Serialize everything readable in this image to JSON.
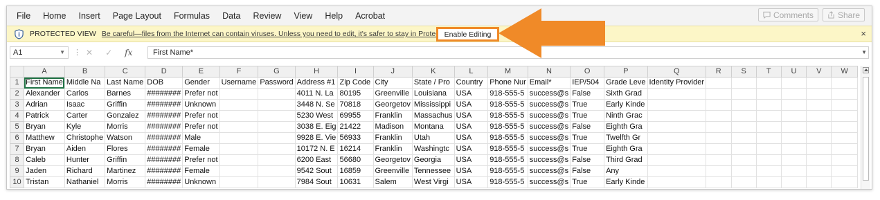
{
  "menu": {
    "items": [
      "File",
      "Home",
      "Insert",
      "Page Layout",
      "Formulas",
      "Data",
      "Review",
      "View",
      "Help",
      "Acrobat"
    ],
    "comments_label": "Comments",
    "share_label": "Share"
  },
  "protected_view": {
    "title": "PROTECTED VIEW",
    "message": "Be careful—files from the Internet can contain viruses. Unless you need to edit, it's safer to stay in Protected View.",
    "button_label": "Enable Editing",
    "close_glyph": "×"
  },
  "formula_bar": {
    "cell_ref": "A1",
    "dots": "⋮",
    "cancel_glyph": "✕",
    "enter_glyph": "✓",
    "fx_glyph": "fx",
    "content": "First Name*"
  },
  "grid": {
    "columns": [
      "A",
      "B",
      "C",
      "D",
      "E",
      "F",
      "G",
      "H",
      "I",
      "J",
      "K",
      "L",
      "M",
      "N",
      "O",
      "P",
      "Q",
      "R",
      "S",
      "T",
      "U",
      "V",
      "W"
    ],
    "row_numbers": [
      "1",
      "2",
      "3",
      "4",
      "5",
      "6",
      "7",
      "8",
      "9",
      "10"
    ],
    "rows": [
      [
        "First Name",
        "Middle Na",
        "Last Name",
        "DOB",
        "Gender",
        "Username",
        "Password",
        "Address #1",
        "Zip Code",
        "City",
        "State / Pro",
        "Country",
        "Phone Nur",
        "Email*",
        "IEP/504",
        "Grade Leve",
        "Identity Provider",
        "",
        "",
        "",
        "",
        "",
        ""
      ],
      [
        "Alexander",
        "Carlos",
        "Barnes",
        "########",
        "Prefer not",
        "",
        "",
        "4011 N. La",
        "80195",
        "Greenville",
        "Louisiana",
        "USA",
        "918-555-5",
        "success@s",
        "False",
        "Sixth Grad",
        "",
        "",
        "",
        "",
        "",
        "",
        ""
      ],
      [
        "Adrian",
        "Isaac",
        "Griffin",
        "########",
        "Unknown",
        "",
        "",
        "3448 N. Se",
        "70818",
        "Georgetov",
        "Mississippi",
        "USA",
        "918-555-5",
        "success@s",
        "True",
        "Early Kinde",
        "",
        "",
        "",
        "",
        "",
        "",
        ""
      ],
      [
        "Patrick",
        "Carter",
        "Gonzalez",
        "########",
        "Prefer not",
        "",
        "",
        "5230 West",
        "69955",
        "Franklin",
        "Massachus",
        "USA",
        "918-555-5",
        "success@s",
        "True",
        "Ninth Grac",
        "",
        "",
        "",
        "",
        "",
        "",
        ""
      ],
      [
        "Bryan",
        "Kyle",
        "Morris",
        "########",
        "Prefer not",
        "",
        "",
        "3038 E. Eig",
        "21422",
        "Madison",
        "Montana",
        "USA",
        "918-555-5",
        "success@s",
        "False",
        "Eighth Gra",
        "",
        "",
        "",
        "",
        "",
        "",
        ""
      ],
      [
        "Matthew",
        "Christophe",
        "Watson",
        "########",
        "Male",
        "",
        "",
        "9928 E. Vie",
        "56933",
        "Franklin",
        "Utah",
        "USA",
        "918-555-5",
        "success@s",
        "True",
        "Twelfth Gr",
        "",
        "",
        "",
        "",
        "",
        "",
        ""
      ],
      [
        "Bryan",
        "Aiden",
        "Flores",
        "########",
        "Female",
        "",
        "",
        "10172 N. E",
        "16214",
        "Franklin",
        "Washingtc",
        "USA",
        "918-555-5",
        "success@s",
        "True",
        "Eighth Gra",
        "",
        "",
        "",
        "",
        "",
        "",
        ""
      ],
      [
        "Caleb",
        "Hunter",
        "Griffin",
        "########",
        "Prefer not",
        "",
        "",
        "6200 East",
        "56680",
        "Georgetov",
        "Georgia",
        "USA",
        "918-555-5",
        "success@s",
        "False",
        "Third Grad",
        "",
        "",
        "",
        "",
        "",
        "",
        ""
      ],
      [
        "Jaden",
        "Richard",
        "Martinez",
        "########",
        "Female",
        "",
        "",
        "9542 Sout",
        "16859",
        "Greenville",
        "Tennessee",
        "USA",
        "918-555-5",
        "success@s",
        "False",
        "Any",
        "",
        "",
        "",
        "",
        "",
        "",
        ""
      ],
      [
        "Tristan",
        "Nathaniel",
        "Morris",
        "########",
        "Unknown",
        "",
        "",
        "7984 Sout",
        "10631",
        "Salem",
        "West Virgi",
        "USA",
        "918-555-5",
        "success@s",
        "True",
        "Early Kinde",
        "",
        "",
        "",
        "",
        "",
        "",
        ""
      ]
    ]
  },
  "colors": {
    "callout_orange": "#f08a28",
    "protected_bg": "#fcf6c7",
    "selection_green": "#1f7244"
  }
}
